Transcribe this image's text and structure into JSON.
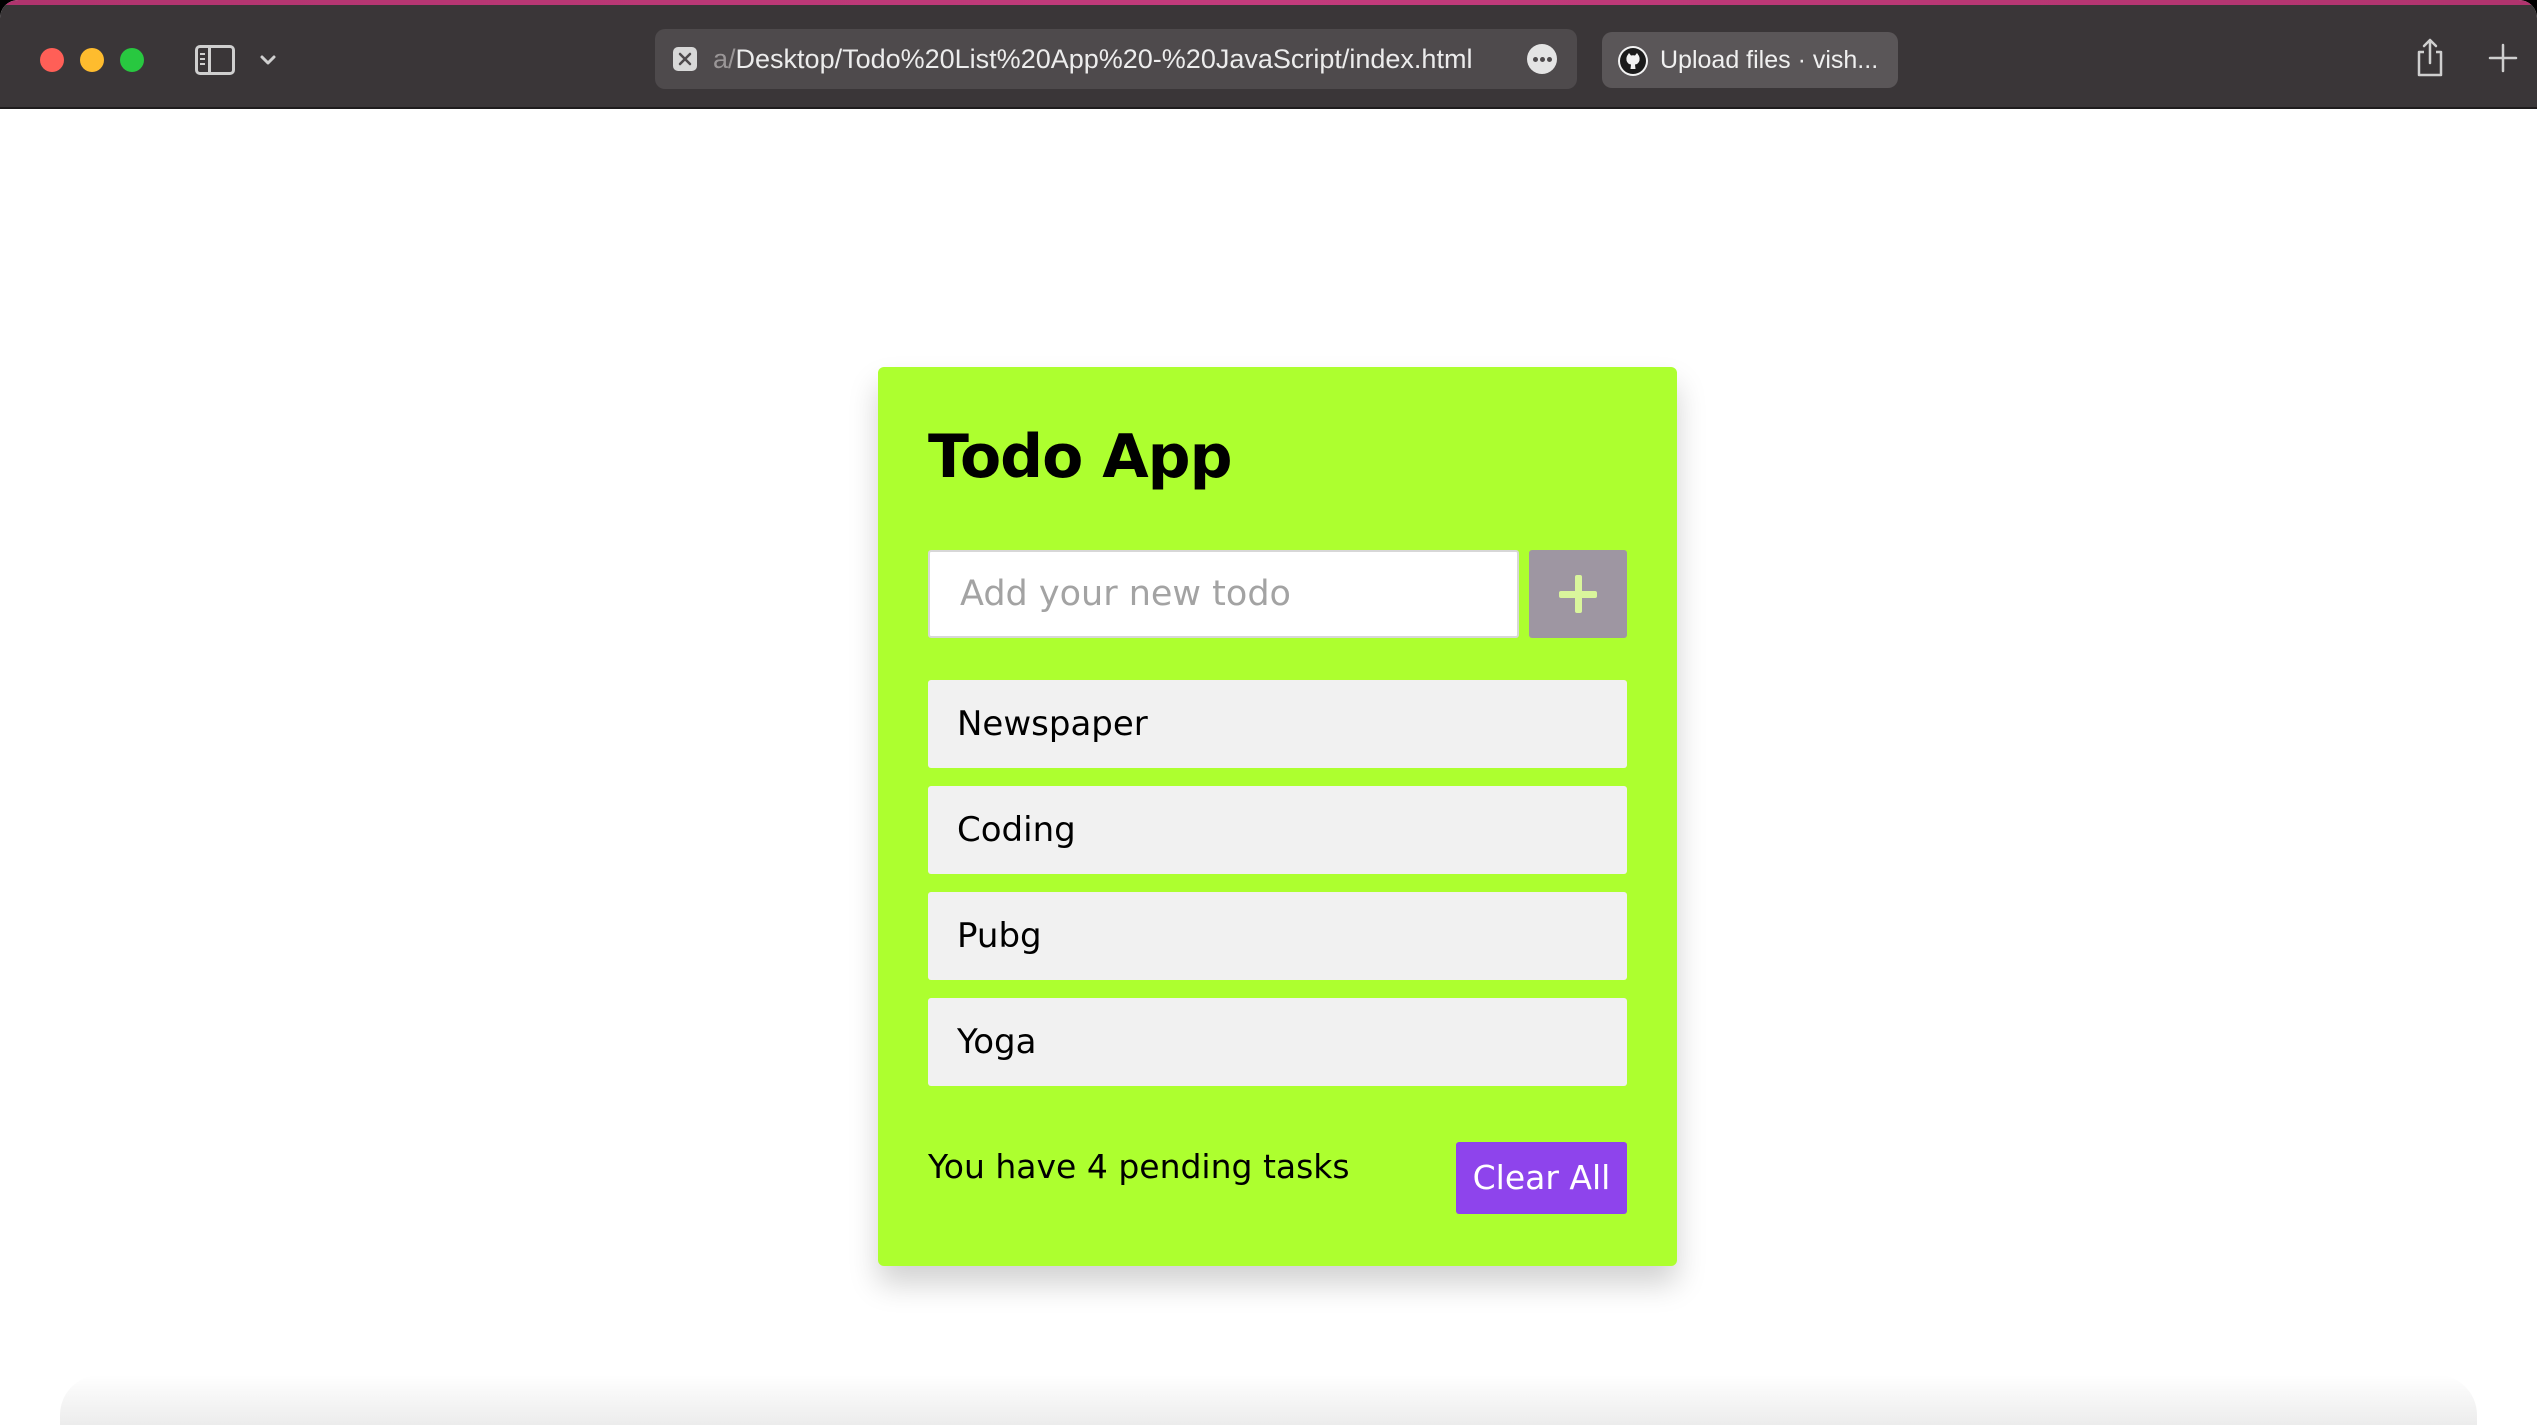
{
  "browser": {
    "address": {
      "prefix": "a/",
      "path": "Desktop/Todo%20List%20App%20-%20JavaScript/index.html"
    },
    "tab": {
      "title": "Upload files · vish..."
    },
    "icons": {
      "sidebar": "sidebar-icon",
      "chevron": "chevron-down-icon",
      "address_status": "close-icon",
      "more": "ellipsis-icon",
      "tab_favicon": "github-icon",
      "share": "share-icon",
      "new_tab": "plus-icon"
    }
  },
  "app": {
    "title": "Todo App",
    "input": {
      "placeholder": "Add your new todo",
      "value": ""
    },
    "add_button_icon": "plus-icon",
    "todos": [
      {
        "text": "Newspaper"
      },
      {
        "text": "Coding"
      },
      {
        "text": "Pubg"
      },
      {
        "text": "Yoga"
      }
    ],
    "footer": {
      "pending_text": "You have 4 pending tasks",
      "clear_label": "Clear All"
    },
    "colors": {
      "card_background": "#adff2f",
      "add_button": "#9e96a2",
      "clear_button": "#8e44ec",
      "item_background": "#f1f1f1"
    }
  }
}
